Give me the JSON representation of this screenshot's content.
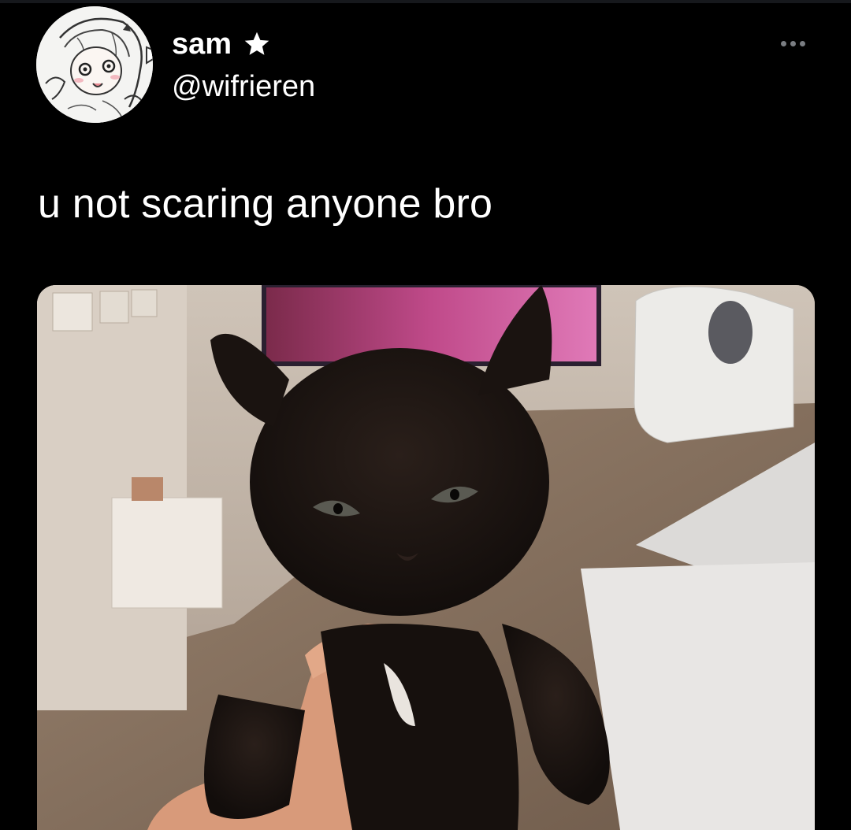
{
  "tweet": {
    "author": {
      "display_name": "sam",
      "badge_icon": "star-icon",
      "handle": "@wifrieren",
      "avatar_icon": "anime-sketch-avatar"
    },
    "more_icon": "more-options-icon",
    "text": "u not scaring anyone bro",
    "media": {
      "description_icon": "photo-black-kitten"
    }
  },
  "colors": {
    "background": "#000000",
    "text": "#ffffff",
    "muted": "#7a7d82"
  }
}
